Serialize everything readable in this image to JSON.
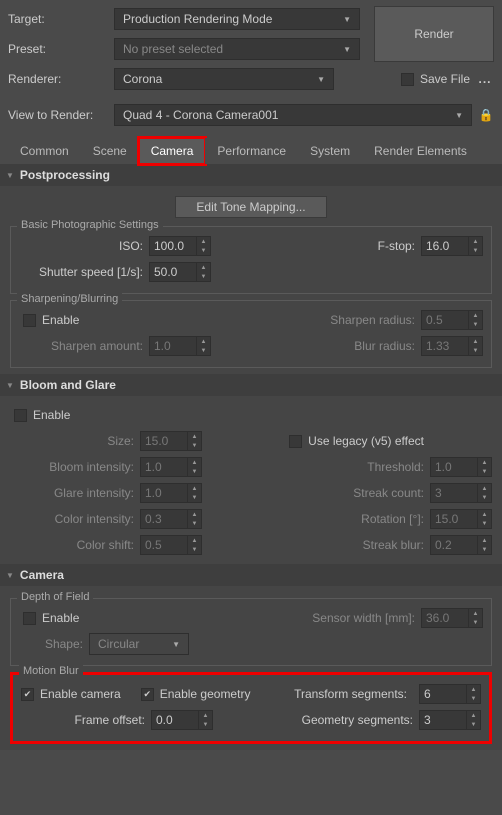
{
  "header": {
    "target_label": "Target:",
    "target_value": "Production Rendering Mode",
    "preset_label": "Preset:",
    "preset_value": "No preset selected",
    "renderer_label": "Renderer:",
    "renderer_value": "Corona",
    "save_file_label": "Save File",
    "render_button": "Render",
    "dots": "...",
    "view_label": "View to Render:",
    "view_value": "Quad 4 - Corona Camera001"
  },
  "tabs": {
    "common": "Common",
    "scene": "Scene",
    "camera": "Camera",
    "performance": "Performance",
    "system": "System",
    "render_elements": "Render Elements"
  },
  "postprocessing": {
    "title": "Postprocessing",
    "edit_tone": "Edit Tone Mapping...",
    "basic_title": "Basic Photographic Settings",
    "iso_label": "ISO:",
    "iso_value": "100.0",
    "fstop_label": "F-stop:",
    "fstop_value": "16.0",
    "shutter_label": "Shutter speed [1/s]:",
    "shutter_value": "50.0",
    "sharp_title": "Sharpening/Blurring",
    "enable_label": "Enable",
    "sharpen_radius_label": "Sharpen radius:",
    "sharpen_radius_value": "0.5",
    "sharpen_amount_label": "Sharpen amount:",
    "sharpen_amount_value": "1.0",
    "blur_radius_label": "Blur radius:",
    "blur_radius_value": "1.33"
  },
  "bloom": {
    "title": "Bloom and Glare",
    "enable_label": "Enable",
    "size_label": "Size:",
    "size_value": "15.0",
    "legacy_label": "Use legacy (v5) effect",
    "bloom_int_label": "Bloom intensity:",
    "bloom_int_value": "1.0",
    "threshold_label": "Threshold:",
    "threshold_value": "1.0",
    "glare_int_label": "Glare intensity:",
    "glare_int_value": "1.0",
    "streak_count_label": "Streak count:",
    "streak_count_value": "3",
    "color_int_label": "Color intensity:",
    "color_int_value": "0.3",
    "rotation_label": "Rotation [°]:",
    "rotation_value": "15.0",
    "color_shift_label": "Color shift:",
    "color_shift_value": "0.5",
    "streak_blur_label": "Streak blur:",
    "streak_blur_value": "0.2"
  },
  "camera": {
    "title": "Camera",
    "dof_title": "Depth of Field",
    "enable_label": "Enable",
    "sensor_label": "Sensor width [mm]:",
    "sensor_value": "36.0",
    "shape_label": "Shape:",
    "shape_value": "Circular",
    "motion_title": "Motion Blur",
    "enable_camera_label": "Enable camera",
    "enable_geometry_label": "Enable geometry",
    "transform_seg_label": "Transform segments:",
    "transform_seg_value": "6",
    "frame_offset_label": "Frame offset:",
    "frame_offset_value": "0.0",
    "geom_seg_label": "Geometry segments:",
    "geom_seg_value": "3"
  }
}
